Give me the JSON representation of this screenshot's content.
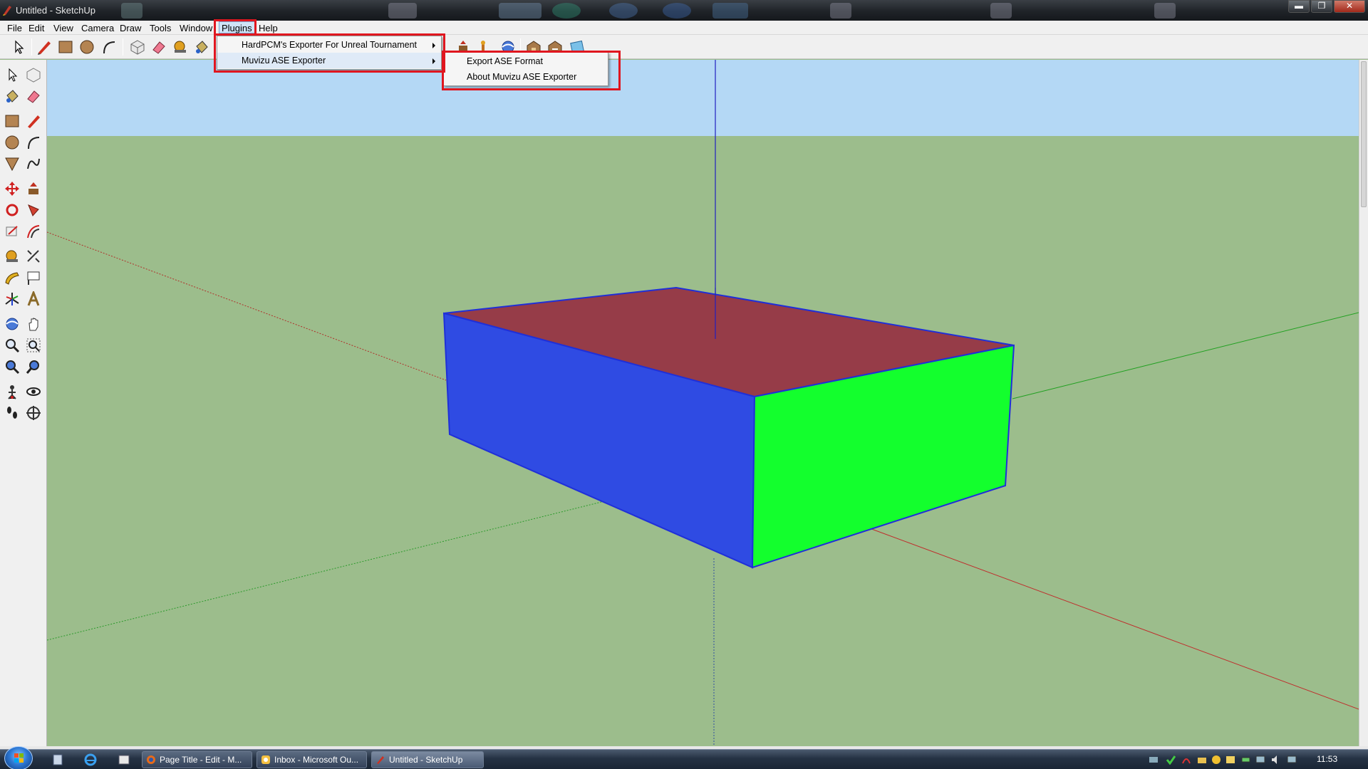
{
  "window": {
    "title": "Untitled - SketchUp",
    "controls": {
      "minimize": "▬",
      "maximize": "❐",
      "close": "✕"
    }
  },
  "menubar": {
    "items": [
      "File",
      "Edit",
      "View",
      "Camera",
      "Draw",
      "Tools",
      "Window",
      "Plugins",
      "Help"
    ],
    "active": "Plugins"
  },
  "plugins_menu": {
    "items": [
      {
        "label": "HardPCM's Exporter For Unreal Tournament",
        "has_submenu": true
      },
      {
        "label": "Muvizu ASE Exporter",
        "has_submenu": true
      }
    ]
  },
  "muvizu_submenu": {
    "items": [
      "Export ASE Format",
      "About Muvizu ASE Exporter"
    ]
  },
  "top_toolbar": {
    "icons": [
      "select-icon",
      "pencil-icon",
      "rectangle-icon",
      "circle-icon",
      "arc-icon",
      "make-component-icon",
      "eraser-icon",
      "tape-measure-icon",
      "paint-bucket-icon",
      "push-pull-icon",
      "move-icon",
      "orbit-icon",
      "warehouse-icon",
      "share-model-icon",
      "google-earth-icon"
    ]
  },
  "left_toolbar": {
    "icons": [
      "select-icon",
      "make-component-icon",
      "paint-bucket-icon",
      "eraser-icon",
      "rectangle-icon",
      "line-icon",
      "circle-icon",
      "arc-icon",
      "polygon-icon",
      "freehand-icon",
      "move-icon",
      "push-pull-icon",
      "rotate-icon",
      "follow-me-icon",
      "scale-icon",
      "offset-icon",
      "tape-measure-icon",
      "dimension-icon",
      "protractor-icon",
      "text-icon",
      "axes-icon",
      "3d-text-icon",
      "orbit-icon",
      "pan-icon",
      "zoom-icon",
      "zoom-window-icon",
      "zoom-extents-icon",
      "previous-view-icon",
      "position-camera-icon",
      "look-around-icon",
      "walk-icon",
      "section-plane-icon"
    ]
  },
  "colors": {
    "sky": "#b4d8f5",
    "ground": "#9cbd8c",
    "box_top": "#963c48",
    "box_front": "#2f4be3",
    "box_side": "#13ff2d",
    "highlight": "#e0161f"
  },
  "taskbar": {
    "buttons": [
      {
        "label": "Page Title - Edit - M...",
        "icon": "firefox-icon"
      },
      {
        "label": "Inbox - Microsoft Ou...",
        "icon": "outlook-icon"
      },
      {
        "label": "Untitled - SketchUp",
        "icon": "sketchup-icon"
      }
    ],
    "clock": "11:53"
  }
}
